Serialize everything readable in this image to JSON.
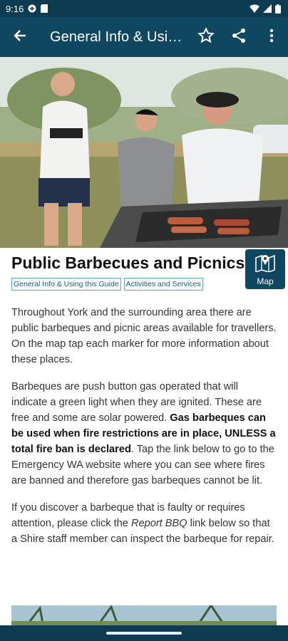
{
  "status_bar": {
    "time": "9:16",
    "icons_left": [
      "sync-icon",
      "sd-card-icon"
    ],
    "icons_right": [
      "wifi-icon",
      "signal-icon",
      "battery-icon"
    ]
  },
  "app_bar": {
    "title": "General Info & Using this Guide",
    "back_icon": "arrow-left-icon",
    "actions": [
      "star-icon",
      "share-icon",
      "more-vert-icon"
    ]
  },
  "page": {
    "title": "Public Barbecues and Picnics",
    "tags": [
      "General Info & Using this Guide",
      "Activities and Services"
    ],
    "map_button_label": "Map",
    "paragraph1": "Throughout York and the surrounding area there are public barbeques and picnic areas available for travellers. On the map tap each marker for more information about these places.",
    "paragraph2": {
      "part1": "Barbeques are push button gas operated that will indicate a green light when they are ignited. These are free and some are solar powered. ",
      "bold": "Gas barbeques can be used when fire restrictions are in place, UNLESS a total fire ban is declared",
      "part2": ". Tap the link below to go to the Emergency WA website where you can see where fires are banned and therefore gas barbeques cannot be lit."
    },
    "paragraph3": {
      "part1": "If you discover a barbeque that is faulty or requires attention, please click the ",
      "italic": "Report BBQ",
      "part2": " link below so that a Shire staff member can inspect the barbeque for repair."
    }
  },
  "colors": {
    "app_bar": "#0f4660",
    "status_bar": "#0c3b52",
    "tag_text": "#1c5f86"
  }
}
